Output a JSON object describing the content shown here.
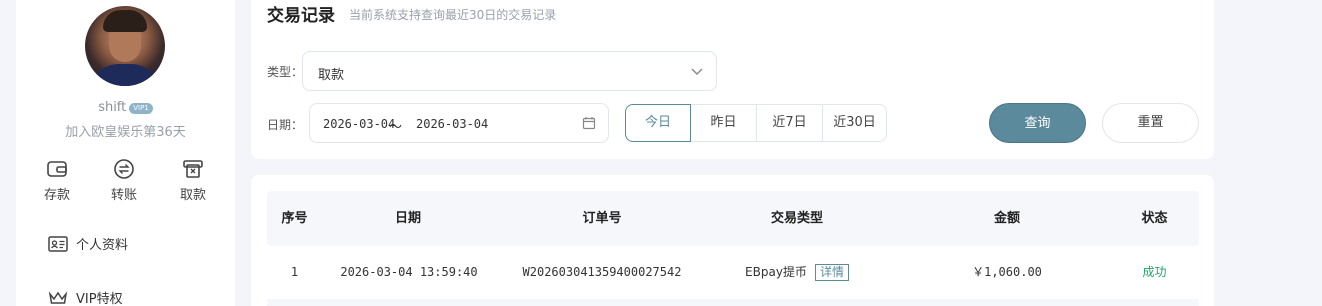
{
  "user": {
    "username": "shift",
    "vip_level": "VIP1",
    "join_text": "加入欧皇娱乐第36天"
  },
  "quick_actions": [
    {
      "label": "存款",
      "icon": "wallet-icon"
    },
    {
      "label": "转账",
      "icon": "transfer-icon"
    },
    {
      "label": "取款",
      "icon": "withdraw-icon"
    }
  ],
  "menu": [
    {
      "label": "个人资料",
      "icon": "profile-card-icon"
    },
    {
      "label": "VIP特权",
      "icon": "crown-icon"
    }
  ],
  "header": {
    "title": "交易记录",
    "subtitle": "当前系统支持查询最近30日的交易记录"
  },
  "filters": {
    "type_label": "类型：",
    "type_value": "取款",
    "date_label": "日期：",
    "date_start": "2026-03-04",
    "date_separator": "～",
    "date_end": "2026-03-04",
    "quick_dates": [
      "今日",
      "昨日",
      "近7日",
      "近30日"
    ],
    "active_quick_date": "今日",
    "query_label": "查询",
    "reset_label": "重置"
  },
  "table": {
    "columns": [
      "序号",
      "日期",
      "订单号",
      "交易类型",
      "金额",
      "状态"
    ],
    "rows": [
      {
        "index": "1",
        "date": "2026-03-04 13:59:40",
        "order_no": "W202603041359400027542",
        "type": "EBpay提币",
        "detail_label": "详情",
        "amount": "￥1,060.00",
        "status": "成功"
      }
    ]
  },
  "colors": {
    "accent": "#5b8a9c",
    "success": "#1fa66a",
    "background": "#f3f5fb"
  }
}
